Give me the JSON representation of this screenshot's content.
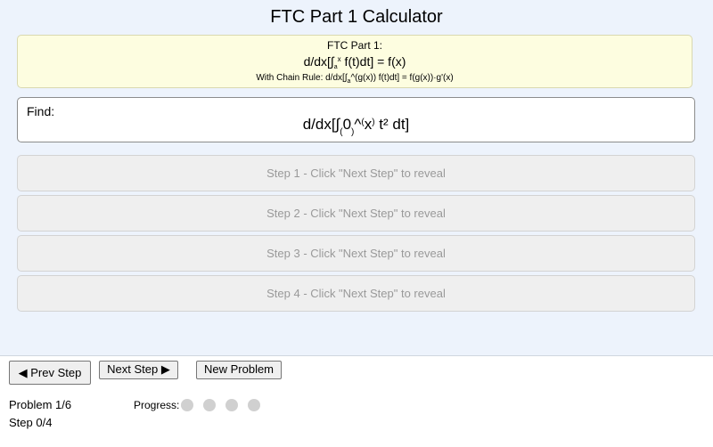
{
  "page_title": "FTC Part 1 Calculator",
  "theorem": {
    "heading": "FTC Part 1:",
    "formula_prefix": "d/dx[∫",
    "formula_lower": "a",
    "formula_upper": "x",
    "formula_suffix": " f(t)dt] = f(x)",
    "chain_prefix": "With Chain Rule: d/dx[∫",
    "chain_lower": "a",
    "chain_suffix": "^(g(x)) f(t)dt] = f(g(x))·g'(x)"
  },
  "find": {
    "label": "Find:",
    "expr_prefix": "d/dx[∫",
    "expr_lower_open": "(",
    "expr_zero": "0",
    "expr_lower_close": ")",
    "expr_caret": "^",
    "expr_upper_open": "(",
    "expr_x": "x",
    "expr_upper_close": ")",
    "expr_suffix": " t² dt]"
  },
  "steps": [
    "Step 1 - Click \"Next Step\" to reveal",
    "Step 2 - Click \"Next Step\" to reveal",
    "Step 3 - Click \"Next Step\" to reveal",
    "Step 4 - Click \"Next Step\" to reveal"
  ],
  "controls": {
    "prev_label": "◀ Prev Step",
    "next_label": "Next Step ▶",
    "new_label": "New Problem"
  },
  "status": {
    "problem": "Problem 1/6",
    "step": "Step 0/4",
    "progress_label": "Progress:",
    "progress_completed": 0,
    "progress_total": 4
  },
  "colors": {
    "background": "#edf3fc",
    "theorem_bg": "#fdfde0",
    "step_text": "#999999",
    "dot_inactive": "#d0d0d0"
  }
}
